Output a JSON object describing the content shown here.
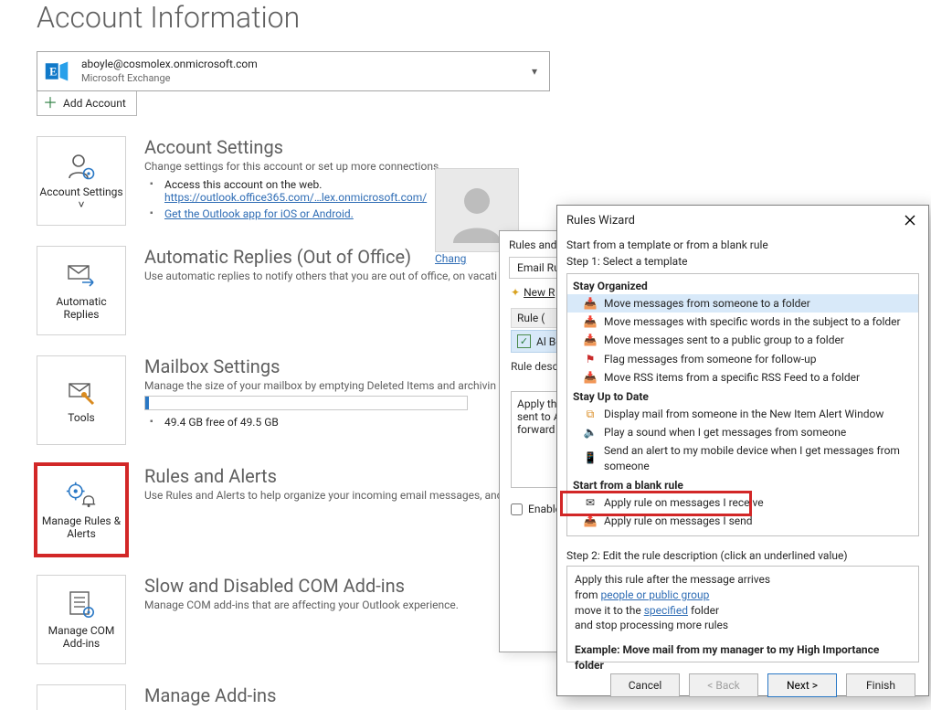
{
  "page": {
    "title": "Account Information",
    "account_email": "aboyle@cosmolex.onmicrosoft.com",
    "account_type": "Microsoft Exchange",
    "add_account": "Add Account",
    "profile_change_link": "Chang"
  },
  "sections": {
    "settings": {
      "tile": "Account Settings ˅",
      "heading": "Account Settings",
      "desc": "Change settings for this account or set up more connections.",
      "bullet_web": "Access this account on the web.",
      "bullet_url": "https://outlook.office365.com/…lex.onmicrosoft.com/",
      "bullet_app": "Get the Outlook app for iOS or Android."
    },
    "autoreplies": {
      "tile": "Automatic Replies",
      "heading": "Automatic Replies (Out of Office)",
      "desc": "Use automatic replies to notify others that you are out of office, on vacati not available to respond to email messages."
    },
    "tools": {
      "tile": "Tools",
      "heading": "Mailbox Settings",
      "desc": "Manage the size of your mailbox by emptying Deleted Items and archivin",
      "storage_free": "49.4 GB free of 49.5 GB"
    },
    "rules": {
      "tile": "Manage Rules & Alerts",
      "heading": "Rules and Alerts",
      "desc": "Use Rules and Alerts to help organize your incoming email messages, and updates when items are added, changed, or removed."
    },
    "com": {
      "tile": "Manage COM Add-ins",
      "heading": "Slow and Disabled COM Add-ins",
      "desc": "Manage COM add-ins that are affecting your Outlook experience."
    },
    "addins": {
      "heading": "Manage Add-ins"
    }
  },
  "rulesDialog": {
    "title": "Rules and",
    "tab": "Email Rules",
    "new_rule": "New R",
    "list_head": "Rule (",
    "row": "Al Boy",
    "desc_label": "Rule descr",
    "desc1": "Apply thi",
    "desc2": "sent to A",
    "desc3": "forward i",
    "enable": "Enable"
  },
  "wizard": {
    "title": "Rules Wizard",
    "start_label": "Start from a template or from a blank rule",
    "step1": "Step 1: Select a template",
    "cat_organized": "Stay Organized",
    "organized": {
      "move_someone": "Move messages from someone to a folder",
      "move_subject": "Move messages with specific words in the subject to a folder",
      "move_group": "Move messages sent to a public group to a folder",
      "flag": "Flag messages from someone for follow-up",
      "move_rss": "Move RSS items from a specific RSS Feed to a folder"
    },
    "cat_uptodate": "Stay Up to Date",
    "uptodate": {
      "display_alert": "Display mail from someone in the New Item Alert Window",
      "play_sound": "Play a sound when I get messages from someone",
      "send_alert": "Send an alert to my mobile device when I get messages from someone"
    },
    "cat_blank": "Start from a blank rule",
    "blank": {
      "receive": "Apply rule on messages I receive",
      "send": "Apply rule on messages I send"
    },
    "step2": "Step 2: Edit the rule description (click an underlined value)",
    "desc_line1": "Apply this rule after the message arrives",
    "desc_from": "from ",
    "desc_people": "people or public group",
    "desc_move": "move it to the ",
    "desc_specified": "specified",
    "desc_move_tail": " folder",
    "desc_stop": "  and stop processing more rules",
    "example": "Example: Move mail from my manager to my High Importance folder",
    "btn_cancel": "Cancel",
    "btn_back": "< Back",
    "btn_next": "Next >",
    "btn_finish": "Finish"
  }
}
